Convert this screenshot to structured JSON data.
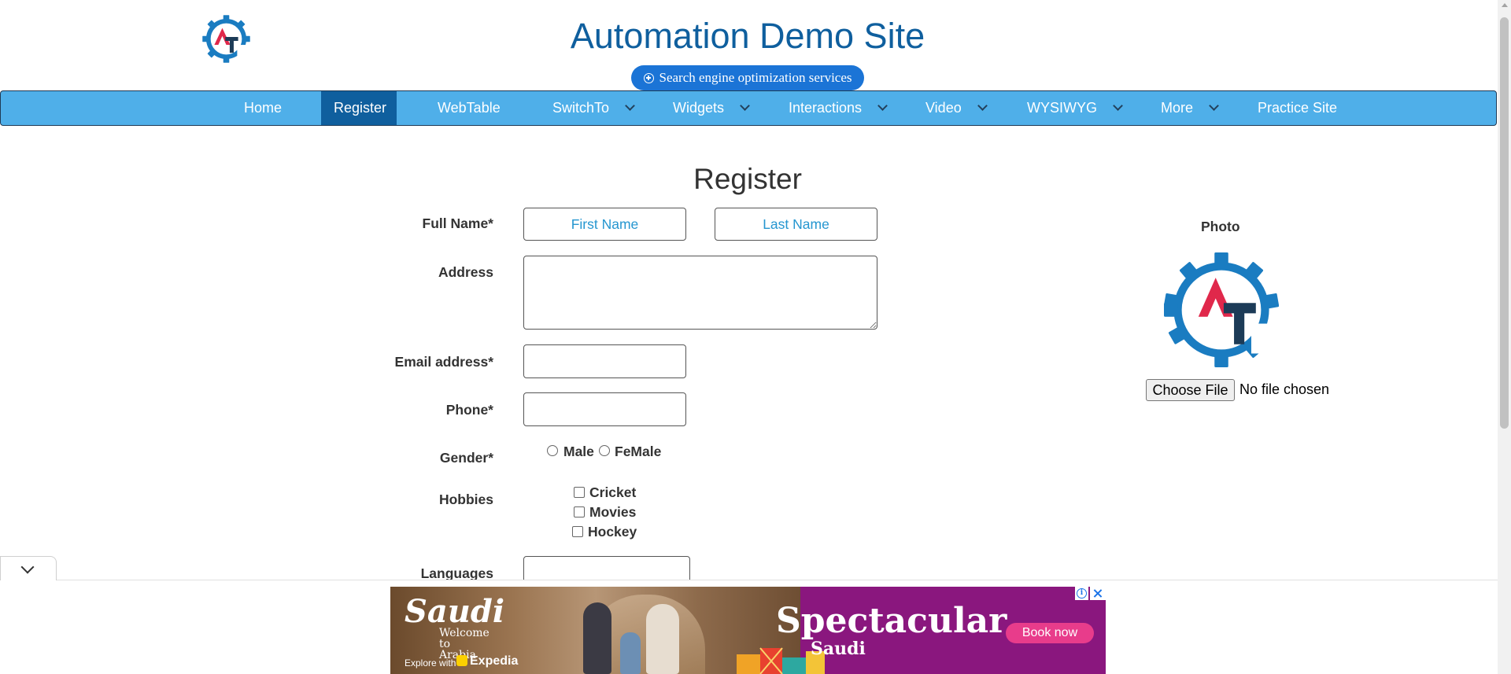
{
  "header": {
    "title": "Automation Demo Site",
    "seo_link": "Search engine optimization services",
    "logo_text": "AT"
  },
  "nav": {
    "items": [
      {
        "label": "Home",
        "dropdown": false
      },
      {
        "label": "Register",
        "dropdown": false,
        "active": true
      },
      {
        "label": "WebTable",
        "dropdown": false
      },
      {
        "label": "SwitchTo",
        "dropdown": true
      },
      {
        "label": "Widgets",
        "dropdown": true
      },
      {
        "label": "Interactions",
        "dropdown": true
      },
      {
        "label": "Video",
        "dropdown": true
      },
      {
        "label": "WYSIWYG",
        "dropdown": true
      },
      {
        "label": "More",
        "dropdown": true
      },
      {
        "label": "Practice Site",
        "dropdown": false
      }
    ]
  },
  "form": {
    "heading": "Register",
    "full_name_label": "Full Name*",
    "first_name_placeholder": "First Name",
    "last_name_placeholder": "Last Name",
    "address_label": "Address",
    "email_label": "Email address*",
    "phone_label": "Phone*",
    "gender_label": "Gender*",
    "gender_options": [
      "Male",
      "FeMale"
    ],
    "hobbies_label": "Hobbies",
    "hobbies": [
      "Cricket",
      "Movies",
      "Hockey"
    ],
    "languages_label": "Languages"
  },
  "photo": {
    "label": "Photo",
    "choose_button": "Choose File",
    "file_status": "No file chosen"
  },
  "ad": {
    "brand": "Saudi",
    "tagline": "Welcome to Arabia",
    "explore": "Explore with",
    "partner": "Expedia",
    "headline": "Spectacular",
    "sub": "Saudi",
    "cta": "Book now"
  },
  "colors": {
    "primary": "#0f5f9e",
    "nav_bg": "#4fafe9",
    "nav_active": "#0f5f9e",
    "seo_pill": "#1b74d6",
    "logo_red": "#e0284b",
    "logo_navy": "#1c3b57",
    "ad_purple": "#8a177e"
  }
}
